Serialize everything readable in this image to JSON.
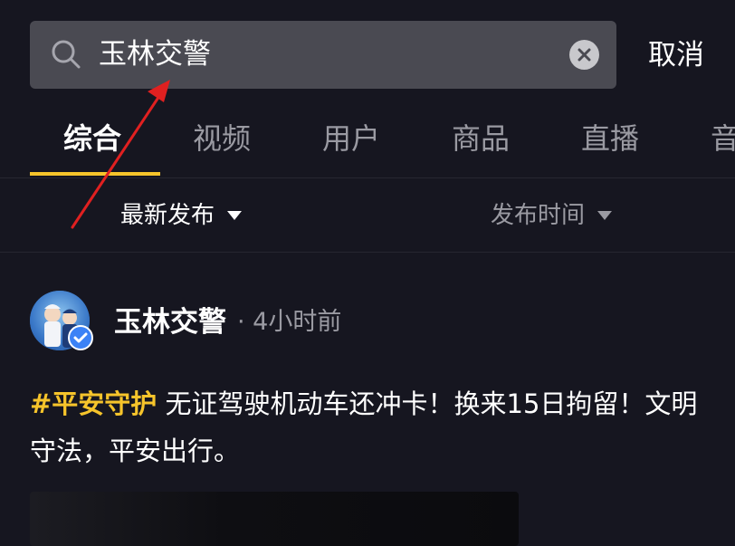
{
  "search": {
    "value": "玉林交警",
    "cancel_label": "取消"
  },
  "tabs": [
    {
      "label": "综合",
      "active": true
    },
    {
      "label": "视频",
      "active": false
    },
    {
      "label": "用户",
      "active": false
    },
    {
      "label": "商品",
      "active": false
    },
    {
      "label": "直播",
      "active": false
    },
    {
      "label": "音",
      "active": false
    }
  ],
  "filters": {
    "sort_label": "最新发布",
    "time_label": "发布时间"
  },
  "post": {
    "username": "玉林交警",
    "time": "· 4小时前",
    "hashtag": "#平安守护",
    "text": " 无证驾驶机动车还冲卡！换来15日拘留！文明守法，平安出行。"
  },
  "colors": {
    "background": "#161620",
    "accent": "#f6c42b",
    "search_bg": "#4a4a52",
    "annotation_arrow": "#e02020"
  },
  "icons": {
    "search": "search-icon",
    "clear": "close-icon",
    "caret": "caret-down-icon",
    "verified": "verified-check-icon"
  }
}
